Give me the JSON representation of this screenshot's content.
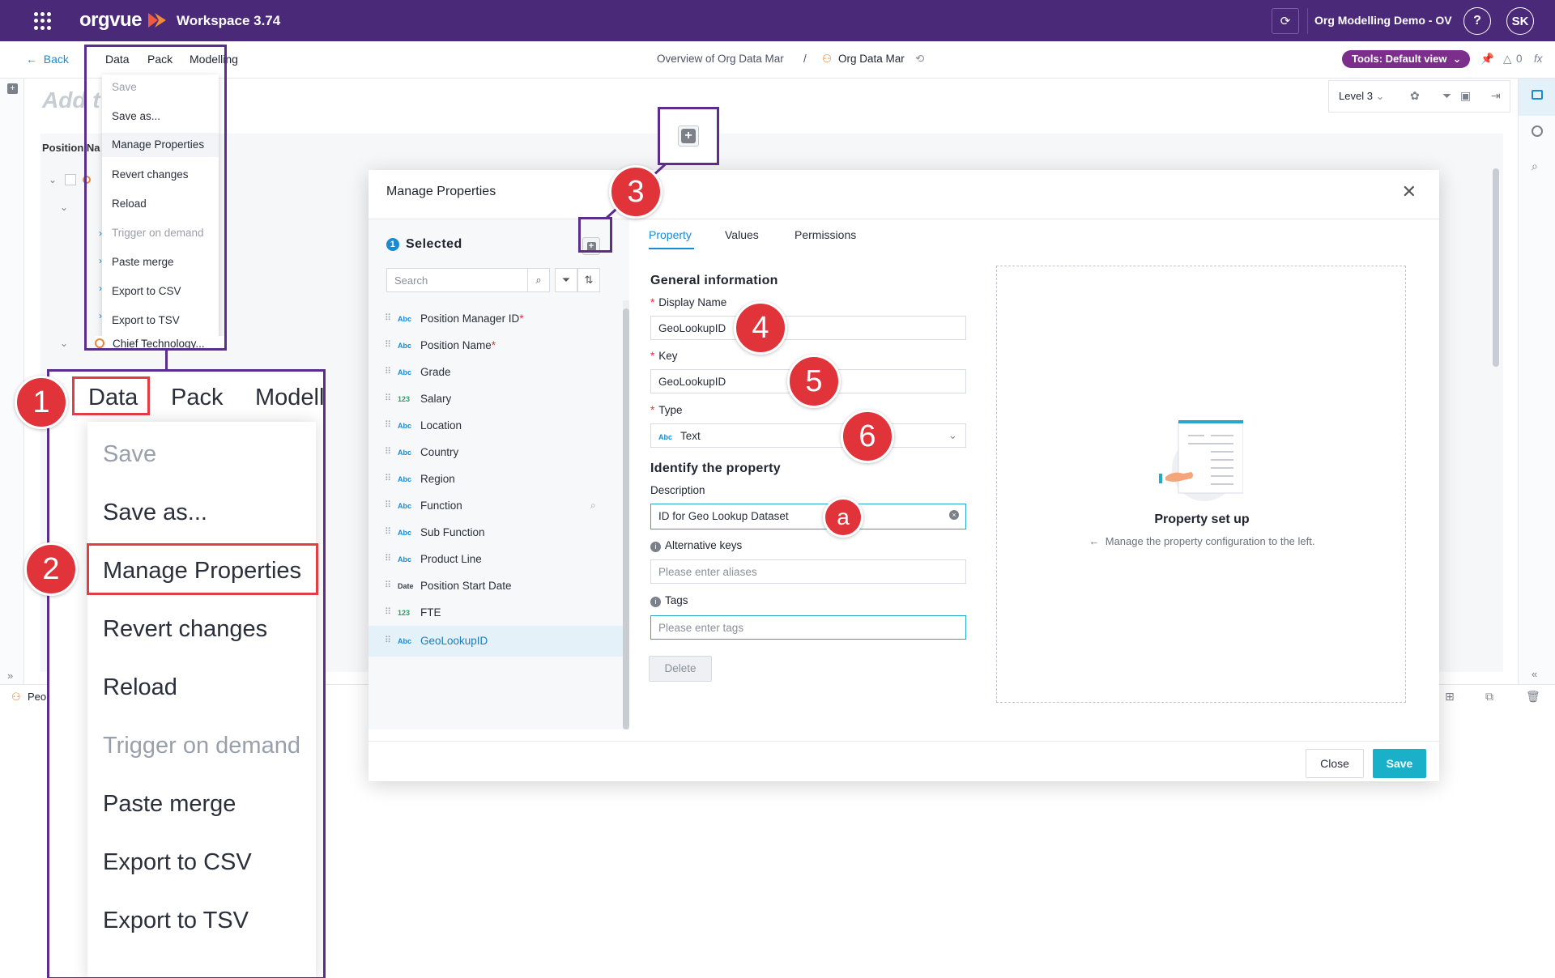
{
  "topbar": {
    "logo": "orgvue",
    "workspace_title": "Workspace  3.74",
    "org_demo": "Org Modelling Demo - OV",
    "help": "?",
    "avatar": "SK"
  },
  "subbar": {
    "back": "Back",
    "menus": [
      "Data",
      "Pack",
      "Modelling"
    ],
    "breadcrumb_1": "Overview of Org Data Mar",
    "breadcrumb_sep": "/",
    "breadcrumb_2": "Org Data Mar",
    "tools_view": "Tools: Default view",
    "count": "0",
    "fx": "fx"
  },
  "workspace": {
    "add_title": "Add t",
    "level": "Level 3",
    "column_head": "Position Na",
    "row_chief": "Chief Technology...",
    "bottom_left": "Peo"
  },
  "data_menu": {
    "items": [
      {
        "label": "Save",
        "disabled": true
      },
      {
        "label": "Save as...",
        "disabled": false
      },
      {
        "label": "Manage Properties",
        "disabled": false
      },
      {
        "label": "Revert changes",
        "disabled": false
      },
      {
        "label": "Reload",
        "disabled": false
      },
      {
        "label": "Trigger on demand",
        "disabled": true
      },
      {
        "label": "Paste merge",
        "disabled": false
      },
      {
        "label": "Export to CSV",
        "disabled": false
      },
      {
        "label": "Export to TSV",
        "disabled": false
      }
    ]
  },
  "zoom": {
    "bar": [
      "Data",
      "Pack",
      "Modell"
    ]
  },
  "badges": {
    "b1": "1",
    "b2": "2",
    "b3": "3",
    "b4": "4",
    "b5": "5",
    "b6": "6",
    "ba": "a"
  },
  "dialog": {
    "title": "Manage Properties",
    "selected_count": "1",
    "selected_label": "Selected",
    "search_placeholder": "Search",
    "properties": [
      {
        "type": "Abc",
        "name": "Position Manager ID",
        "required": true
      },
      {
        "type": "Abc",
        "name": "Position Name",
        "required": true
      },
      {
        "type": "Abc",
        "name": "Grade",
        "required": false
      },
      {
        "type": "123",
        "name": "Salary",
        "required": false
      },
      {
        "type": "Abc",
        "name": "Location",
        "required": false
      },
      {
        "type": "Abc",
        "name": "Country",
        "required": false
      },
      {
        "type": "Abc",
        "name": "Region",
        "required": false
      },
      {
        "type": "Abc",
        "name": "Function",
        "required": false
      },
      {
        "type": "Abc",
        "name": "Sub Function",
        "required": false
      },
      {
        "type": "Abc",
        "name": "Product Line",
        "required": false
      },
      {
        "type": "Date",
        "name": "Position Start Date",
        "required": false
      },
      {
        "type": "123",
        "name": "FTE",
        "required": false
      },
      {
        "type": "Abc",
        "name": "GeoLookupID",
        "required": false
      }
    ],
    "tabs": [
      "Property",
      "Values",
      "Permissions"
    ],
    "general_info": "General information",
    "display_name_label": "Display Name",
    "display_name_value": "GeoLookupID",
    "key_label": "Key",
    "key_value": "GeoLookupID",
    "type_label": "Type",
    "type_badge": "Abc",
    "type_value": "Text",
    "identify": "Identify the property",
    "description_label": "Description",
    "description_value": "ID for Geo Lookup Dataset",
    "alt_keys_label": "Alternative keys",
    "alt_keys_placeholder": "Please enter aliases",
    "tags_label": "Tags",
    "tags_placeholder": "Please enter tags",
    "delete": "Delete",
    "setup_title": "Property set up",
    "setup_sub": "Manage the property configuration to the left.",
    "close_btn": "Close",
    "save_btn": "Save"
  },
  "colors": {
    "topbar": "#4a2a78",
    "annotation": "#5b2d8c",
    "badge": "#e0343a",
    "accent": "#1a8ad1",
    "save": "#1ab0c9"
  }
}
